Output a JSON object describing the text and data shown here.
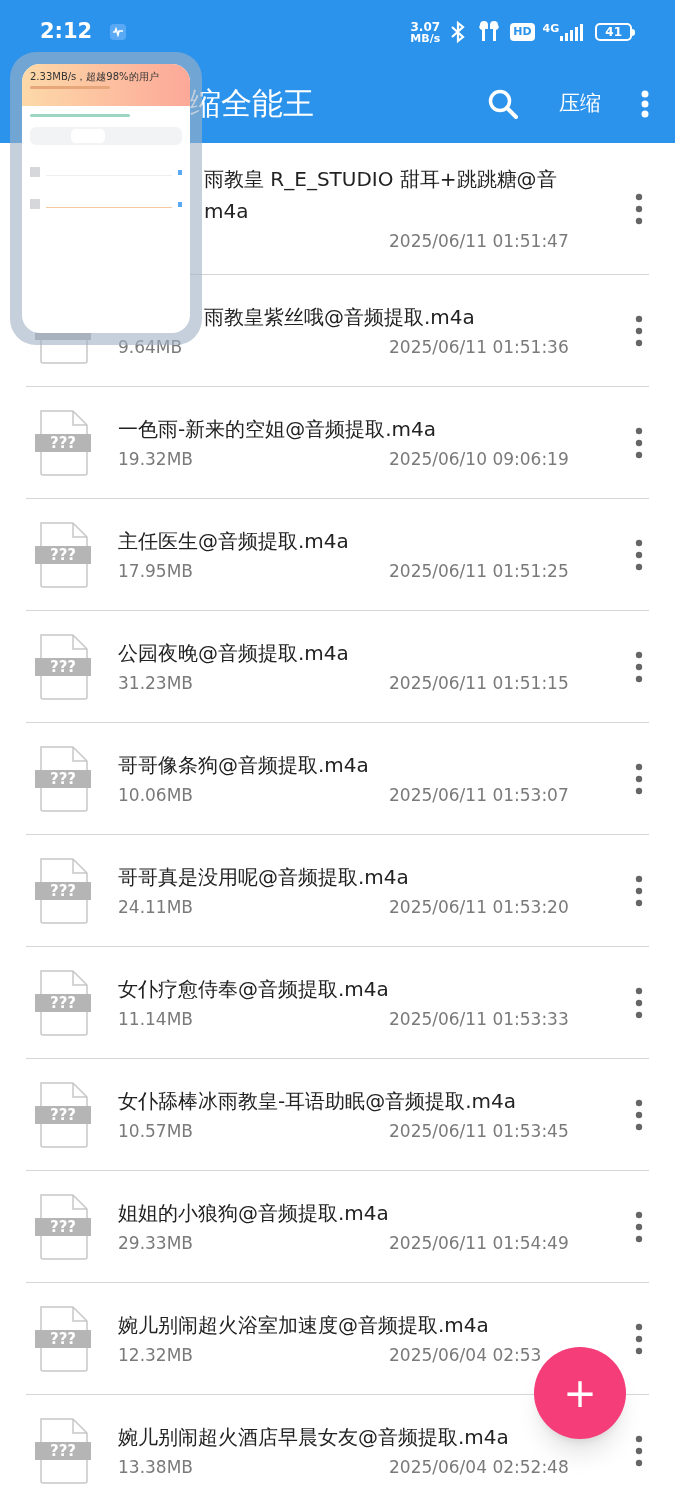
{
  "status_bar": {
    "time": "2:12",
    "speed_value": "3.07",
    "speed_unit": "MB/s",
    "hd": "HD",
    "network": "4G",
    "battery": "41"
  },
  "app_bar": {
    "title": "缩全能王",
    "action": "压缩"
  },
  "preview": {
    "headline": "2.33MB/s，超越98%的用户"
  },
  "files": [
    {
      "name": "雨教皇 R_E_STUDIO 甜耳+跳跳糖@音\nm4a",
      "date": "2025/06/11 01:51:47"
    },
    {
      "name": "雨教皇紫丝哦@音频提取.m4a",
      "size": "9.64MB",
      "date": "2025/06/11 01:51:36"
    },
    {
      "icon_label": "???",
      "name": "一色雨-新来的空姐@音频提取.m4a",
      "size": "19.32MB",
      "date": "2025/06/10 09:06:19"
    },
    {
      "icon_label": "???",
      "name": "主任医生@音频提取.m4a",
      "size": "17.95MB",
      "date": "2025/06/11 01:51:25"
    },
    {
      "icon_label": "???",
      "name": "公园夜晚@音频提取.m4a",
      "size": "31.23MB",
      "date": "2025/06/11 01:51:15"
    },
    {
      "icon_label": "???",
      "name": "哥哥像条狗@音频提取.m4a",
      "size": "10.06MB",
      "date": "2025/06/11 01:53:07"
    },
    {
      "icon_label": "???",
      "name": "哥哥真是没用呢@音频提取.m4a",
      "size": "24.11MB",
      "date": "2025/06/11 01:53:20"
    },
    {
      "icon_label": "???",
      "name": "女仆疗愈侍奉@音频提取.m4a",
      "size": "11.14MB",
      "date": "2025/06/11 01:53:33"
    },
    {
      "icon_label": "???",
      "name": "女仆舔棒冰雨教皇-耳语助眠@音频提取.m4a",
      "size": "10.57MB",
      "date": "2025/06/11 01:53:45"
    },
    {
      "icon_label": "???",
      "name": "姐姐的小狼狗@音频提取.m4a",
      "size": "29.33MB",
      "date": "2025/06/11 01:54:49"
    },
    {
      "icon_label": "???",
      "name": "婉儿别闹超火浴室加速度@音频提取.m4a",
      "size": "12.32MB",
      "date": "2025/06/04 02:53"
    },
    {
      "icon_label": "???",
      "name": "婉儿别闹超火酒店早晨女友@音频提取.m4a",
      "size": "13.38MB",
      "date": "2025/06/04 02:52:48"
    }
  ],
  "fab": {
    "label": "+"
  }
}
